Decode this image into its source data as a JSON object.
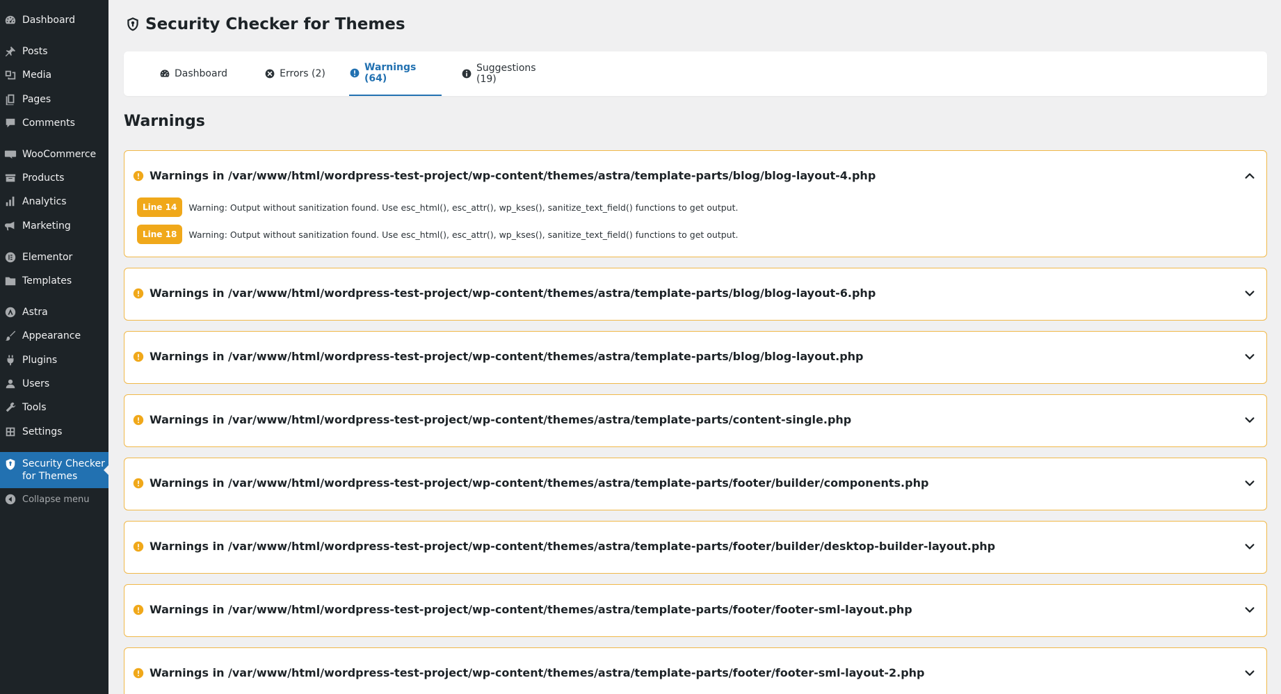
{
  "sidebar": {
    "items": [
      {
        "label": "Dashboard",
        "icon": "dashboard-icon"
      },
      {
        "label": "Posts",
        "icon": "pin-icon"
      },
      {
        "label": "Media",
        "icon": "media-icon"
      },
      {
        "label": "Pages",
        "icon": "pages-icon"
      },
      {
        "label": "Comments",
        "icon": "comment-icon"
      },
      {
        "label": "WooCommerce",
        "icon": "woocommerce-icon"
      },
      {
        "label": "Products",
        "icon": "archive-icon"
      },
      {
        "label": "Analytics",
        "icon": "chart-bar-icon"
      },
      {
        "label": "Marketing",
        "icon": "megaphone-icon"
      },
      {
        "label": "Elementor",
        "icon": "elementor-icon"
      },
      {
        "label": "Templates",
        "icon": "folder-icon"
      },
      {
        "label": "Astra",
        "icon": "astra-icon"
      },
      {
        "label": "Appearance",
        "icon": "brush-icon"
      },
      {
        "label": "Plugins",
        "icon": "plugin-icon"
      },
      {
        "label": "Users",
        "icon": "user-icon"
      },
      {
        "label": "Tools",
        "icon": "wrench-icon"
      },
      {
        "label": "Settings",
        "icon": "settings-icon"
      }
    ],
    "active": {
      "label_line1": "Security Checker",
      "label_line2": "for Themes",
      "icon": "shield-icon"
    },
    "collapse": {
      "label": "Collapse menu",
      "icon": "collapse-icon"
    }
  },
  "page": {
    "title": "Security Checker for Themes",
    "icon": "shield-icon"
  },
  "tabs": [
    {
      "label": "Dashboard",
      "icon": "dashboard-icon"
    },
    {
      "label": "Errors (2)",
      "icon": "error-icon"
    },
    {
      "label": "Warnings (64)",
      "icon": "warning-icon",
      "active": true
    },
    {
      "label": "Suggestions (19)",
      "icon": "info-icon"
    }
  ],
  "section": {
    "title": "Warnings"
  },
  "panels": [
    {
      "title": "Warnings in /var/www/html/wordpress-test-project/wp-content/themes/astra/template-parts/blog/blog-layout-4.php",
      "expanded": true,
      "lines": [
        {
          "badge": "Line 14",
          "text": "Warning: Output without sanitization found. Use esc_html(), esc_attr(), wp_kses(), sanitize_text_field() functions to get output."
        },
        {
          "badge": "Line 18",
          "text": "Warning: Output without sanitization found. Use esc_html(), esc_attr(), wp_kses(), sanitize_text_field() functions to get output."
        }
      ]
    },
    {
      "title": "Warnings in /var/www/html/wordpress-test-project/wp-content/themes/astra/template-parts/blog/blog-layout-6.php",
      "expanded": false
    },
    {
      "title": "Warnings in /var/www/html/wordpress-test-project/wp-content/themes/astra/template-parts/blog/blog-layout.php",
      "expanded": false
    },
    {
      "title": "Warnings in /var/www/html/wordpress-test-project/wp-content/themes/astra/template-parts/content-single.php",
      "expanded": false
    },
    {
      "title": "Warnings in /var/www/html/wordpress-test-project/wp-content/themes/astra/template-parts/footer/builder/components.php",
      "expanded": false
    },
    {
      "title": "Warnings in /var/www/html/wordpress-test-project/wp-content/themes/astra/template-parts/footer/builder/desktop-builder-layout.php",
      "expanded": false
    },
    {
      "title": "Warnings in /var/www/html/wordpress-test-project/wp-content/themes/astra/template-parts/footer/footer-sml-layout.php",
      "expanded": false
    },
    {
      "title": "Warnings in /var/www/html/wordpress-test-project/wp-content/themes/astra/template-parts/footer/footer-sml-layout-2.php",
      "expanded": false
    }
  ],
  "colors": {
    "accent": "#2271b1",
    "warning": "#f0a81a",
    "sidebar": "#1d2327",
    "panel_border": "#f0b849"
  }
}
